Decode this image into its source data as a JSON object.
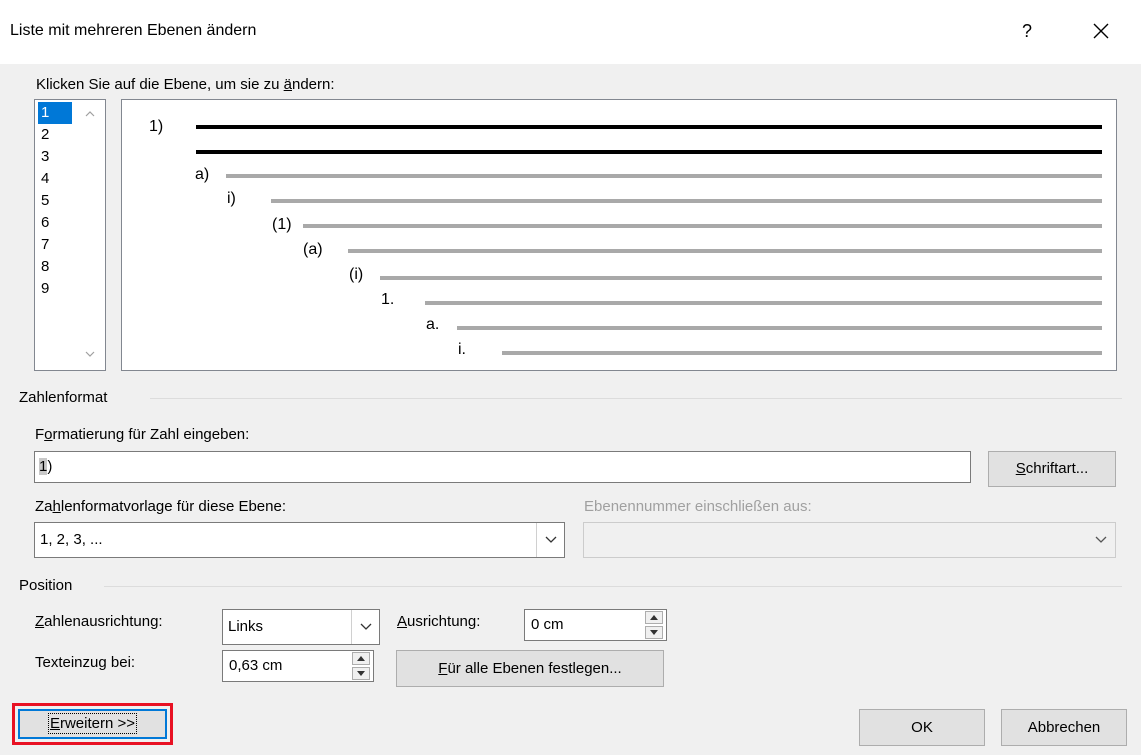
{
  "dialog": {
    "title": "Liste mit mehreren Ebenen ändern",
    "help_label": "?"
  },
  "levels": {
    "prompt_pre": "Klicken Sie auf die Ebene, um sie zu ",
    "prompt_accel": "ä",
    "prompt_post": "ndern:",
    "items": [
      "1",
      "2",
      "3",
      "4",
      "5",
      "6",
      "7",
      "8",
      "9"
    ],
    "selected": "1"
  },
  "preview": {
    "labels": [
      "1)",
      "a)",
      "i)",
      "(1)",
      "(a)",
      "(i)",
      "1.",
      "a.",
      "i."
    ]
  },
  "number_format": {
    "group_label": "Zahlenformat",
    "format_label_accel": "o",
    "format_label_pre": "F",
    "format_label_post": "rmatierung für Zahl eingeben:",
    "format_value_highlight": "1",
    "format_value_rest": ")",
    "font_button_accel": "S",
    "font_button_rest": "chriftart...",
    "style_label_pre": "Za",
    "style_label_accel": "h",
    "style_label_post": "lenformatvorlage für diese Ebene:",
    "style_value": "1, 2, 3, ...",
    "include_label": "Ebenennummer einschließen aus:",
    "include_value": ""
  },
  "position": {
    "group_label": "Position",
    "alignment_label_accel": "Z",
    "alignment_label_rest": "ahlenausrichtung:",
    "alignment_value": "Links",
    "aligned_at_label_accel": "A",
    "aligned_at_label_rest": "usrichtung:",
    "aligned_at_value": "0 cm",
    "indent_label_pre": "Texteinzu",
    "indent_label_accel": "g",
    "indent_label_post": " bei:",
    "indent_value": "0,63 cm",
    "set_all_accel": "F",
    "set_all_rest": "ür alle Ebenen festlegen..."
  },
  "footer": {
    "more_accel": "E",
    "more_rest": "rweitern >>",
    "ok_label": "OK",
    "cancel_label": "Abbrechen",
    "highlight_color": "#e81123",
    "focus_color": "#0078d7"
  }
}
